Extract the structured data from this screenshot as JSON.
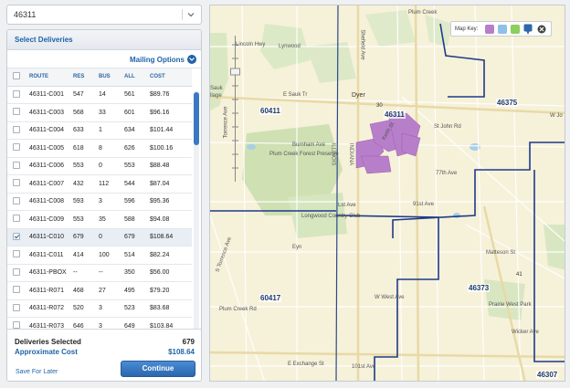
{
  "zip_select": {
    "value": "46311"
  },
  "panel": {
    "title": "Select Deliveries",
    "mailing_options": "Mailing Options",
    "columns": [
      "ROUTE",
      "RES",
      "BUS",
      "ALL",
      "COST"
    ],
    "rows": [
      {
        "route": "46311-C001",
        "res": "547",
        "bus": "14",
        "all": "561",
        "cost": "$89.76",
        "checked": false
      },
      {
        "route": "46311-C003",
        "res": "568",
        "bus": "33",
        "all": "601",
        "cost": "$96.16",
        "checked": false
      },
      {
        "route": "46311-C004",
        "res": "633",
        "bus": "1",
        "all": "634",
        "cost": "$101.44",
        "checked": false
      },
      {
        "route": "46311-C005",
        "res": "618",
        "bus": "8",
        "all": "626",
        "cost": "$100.16",
        "checked": false
      },
      {
        "route": "46311-C006",
        "res": "553",
        "bus": "0",
        "all": "553",
        "cost": "$88.48",
        "checked": false
      },
      {
        "route": "46311-C007",
        "res": "432",
        "bus": "112",
        "all": "544",
        "cost": "$87.04",
        "checked": false
      },
      {
        "route": "46311-C008",
        "res": "593",
        "bus": "3",
        "all": "596",
        "cost": "$95.36",
        "checked": false
      },
      {
        "route": "46311-C009",
        "res": "553",
        "bus": "35",
        "all": "588",
        "cost": "$94.08",
        "checked": false
      },
      {
        "route": "46311-C010",
        "res": "679",
        "bus": "0",
        "all": "679",
        "cost": "$108.64",
        "checked": true
      },
      {
        "route": "46311-C011",
        "res": "414",
        "bus": "100",
        "all": "514",
        "cost": "$82.24",
        "checked": false
      },
      {
        "route": "46311-PBOX",
        "res": "--",
        "bus": "--",
        "all": "350",
        "cost": "$56.00",
        "checked": false
      },
      {
        "route": "46311-R071",
        "res": "468",
        "bus": "27",
        "all": "495",
        "cost": "$79.20",
        "checked": false
      },
      {
        "route": "46311-R072",
        "res": "520",
        "bus": "3",
        "all": "523",
        "cost": "$83.68",
        "checked": false
      },
      {
        "route": "46311-R073",
        "res": "646",
        "bus": "3",
        "all": "649",
        "cost": "$103.84",
        "checked": false
      }
    ],
    "deliveries_selected_label": "Deliveries Selected",
    "deliveries_selected_value": "679",
    "approx_cost_label": "Approximate Cost",
    "approx_cost_value": "$108.64",
    "save_later": "Save For Later",
    "continue": "Continue"
  },
  "map": {
    "key_label": "Map Key:",
    "key_colors": [
      "#b77fc9",
      "#8fc0e8",
      "#8ccf5a",
      "#2f67a8"
    ],
    "zips": [
      "46311",
      "46375",
      "60411",
      "60417",
      "46373",
      "46307"
    ],
    "labels": {
      "lincoln_hwy": "Lincoln Hwy",
      "lynwood": "Lynwood",
      "sauk": "Sauk",
      "llage": "llage",
      "e_sauk_tr": "E Sauk Tr",
      "dyer": "Dyer",
      "hwy30": "30",
      "w_jo": "W Jo",
      "shefield": "Shefield Ave",
      "plum_creek": "Plum Creek",
      "burnham": "Burnham Ave",
      "illinois": "ILLINOIS",
      "indiana": "INDIANA",
      "plum_creek_fp": "Plum Creek Forest Preserve",
      "ave77": "77th Ave",
      "ave91": "91st Ave",
      "st_johns": "St John Rd",
      "st_ave": "Lst Ave",
      "longwood": "Longwood Country Club",
      "torrence": "Torrence Ave",
      "s_torrence": "S Torrence Ave",
      "keith": "Keith St",
      "hwy41": "41",
      "matteson": "Matteson St",
      "w_west": "W West Ave",
      "prairie": "Prairie West Park",
      "wicker": "Wicker Ave",
      "e_exchange": "E Exchange St",
      "ave101": "101st Ave",
      "plum_creek_rd": "Plum Creek Rd",
      "eyn": "Eyn"
    }
  }
}
